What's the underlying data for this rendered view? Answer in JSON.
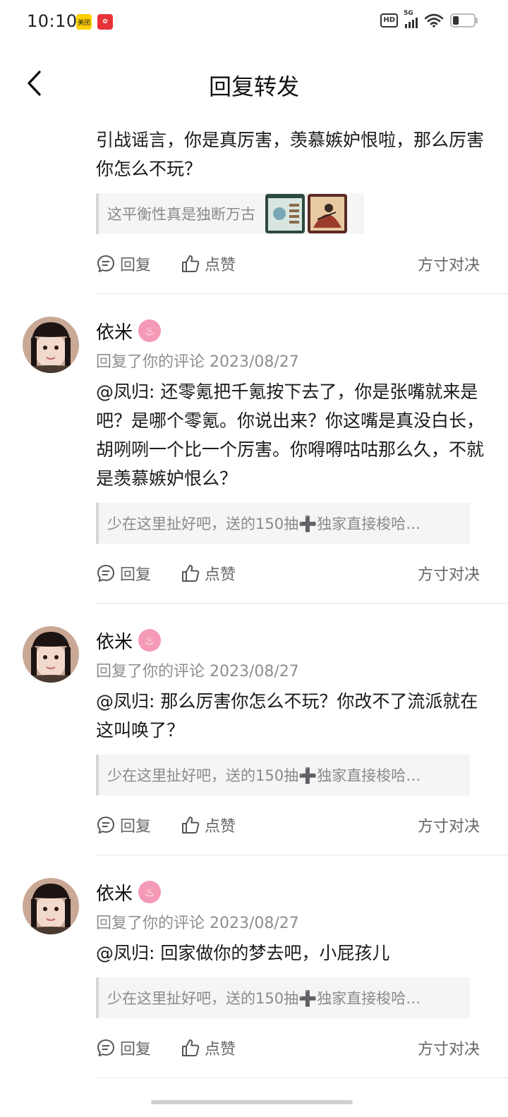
{
  "status_bar": {
    "time": "10:10",
    "app_badges": [
      "美团",
      ""
    ],
    "network": "5G",
    "hd": "HD"
  },
  "nav": {
    "title": "回复转发"
  },
  "top_item": {
    "text": "引战谣言，你是真厉害，羡慕嫉妒恨啦，那么厉害你怎么不玩？",
    "quote": "这平衡性真是独断万古",
    "reply_label": "回复",
    "like_label": "点赞",
    "topic": "方寸对决"
  },
  "comments": [
    {
      "username": "依米",
      "meta": "回复了你的评论 2023/08/27",
      "text": "@凤归: 还零氪把千氪按下去了，你是张嘴就来是吧？是哪个零氪。你说出来？你这嘴是真没白长，胡咧咧一个比一个厉害。你嘚嘚咕咕那么久，不就是羡慕嫉妒恨么？",
      "quote": "少在这里扯好吧，送的150抽➕独家直接梭哈…",
      "reply_label": "回复",
      "like_label": "点赞",
      "topic": "方寸对决"
    },
    {
      "username": "依米",
      "meta": "回复了你的评论 2023/08/27",
      "text": "@凤归: 那么厉害你怎么不玩？你改不了流派就在这叫唤了？",
      "quote": "少在这里扯好吧，送的150抽➕独家直接梭哈…",
      "reply_label": "回复",
      "like_label": "点赞",
      "topic": "方寸对决"
    },
    {
      "username": "依米",
      "meta": "回复了你的评论 2023/08/27",
      "text": "@凤归: 回家做你的梦去吧，小屁孩儿",
      "quote": "少在这里扯好吧，送的150抽➕独家直接梭哈…",
      "reply_label": "回复",
      "like_label": "点赞",
      "topic": "方寸对决"
    }
  ]
}
